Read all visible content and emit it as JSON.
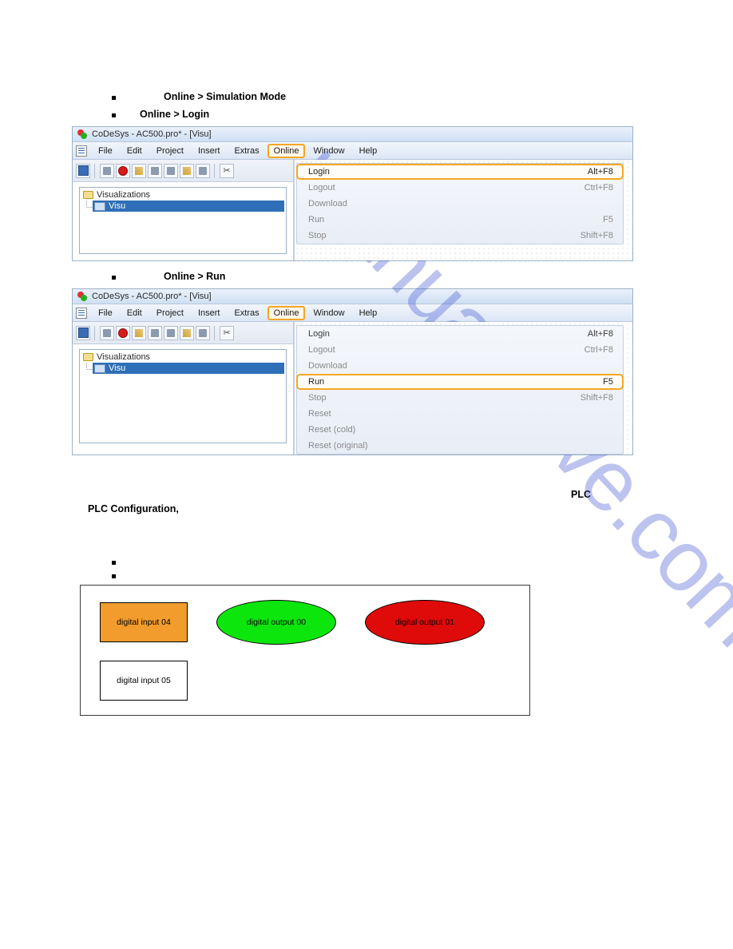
{
  "watermark": "manualshive.com",
  "bullets": {
    "b1": "Online > Simulation Mode",
    "b2": "Online > Login",
    "b3": "Online > Run"
  },
  "win1": {
    "title": "CoDeSys - AC500.pro* - [Visu]",
    "menus": [
      "File",
      "Edit",
      "Project",
      "Insert",
      "Extras",
      "Online",
      "Window",
      "Help"
    ],
    "tree_root": "Visualizations",
    "tree_item": "Visu",
    "dropdown": [
      {
        "label": "Login",
        "short": "Alt+F8",
        "hl": true,
        "dis": false
      },
      {
        "label": "Logout",
        "short": "Ctrl+F8",
        "hl": false,
        "dis": true
      },
      {
        "label": "Download",
        "short": "",
        "hl": false,
        "dis": true
      },
      {
        "label": "Run",
        "short": "F5",
        "hl": false,
        "dis": true
      },
      {
        "label": "Stop",
        "short": "Shift+F8",
        "hl": false,
        "dis": true
      }
    ]
  },
  "win2": {
    "title": "CoDeSys - AC500.pro* - [Visu]",
    "menus": [
      "File",
      "Edit",
      "Project",
      "Insert",
      "Extras",
      "Online",
      "Window",
      "Help"
    ],
    "tree_root": "Visualizations",
    "tree_item": "Visu",
    "dropdown": [
      {
        "label": "Login",
        "short": "Alt+F8",
        "hl": false,
        "dis": false
      },
      {
        "label": "Logout",
        "short": "Ctrl+F8",
        "hl": false,
        "dis": true
      },
      {
        "label": "Download",
        "short": "",
        "hl": false,
        "dis": true
      },
      {
        "label": "Run",
        "short": "F5",
        "hl": true,
        "dis": false
      },
      {
        "label": "Stop",
        "short": "Shift+F8",
        "hl": false,
        "dis": true
      },
      {
        "label": "Reset",
        "short": "",
        "hl": false,
        "dis": true
      },
      {
        "label": "Reset (cold)",
        "short": "",
        "hl": false,
        "dis": true
      },
      {
        "label": "Reset (original)",
        "short": "",
        "hl": false,
        "dis": true
      }
    ]
  },
  "para": {
    "part1": "",
    "plc": "PLC Configuration,",
    "part2": ""
  },
  "vis": {
    "di04": "digital input 04",
    "do00": "digital output 00",
    "do01": "digital output 01",
    "di05": "digital input 05"
  }
}
